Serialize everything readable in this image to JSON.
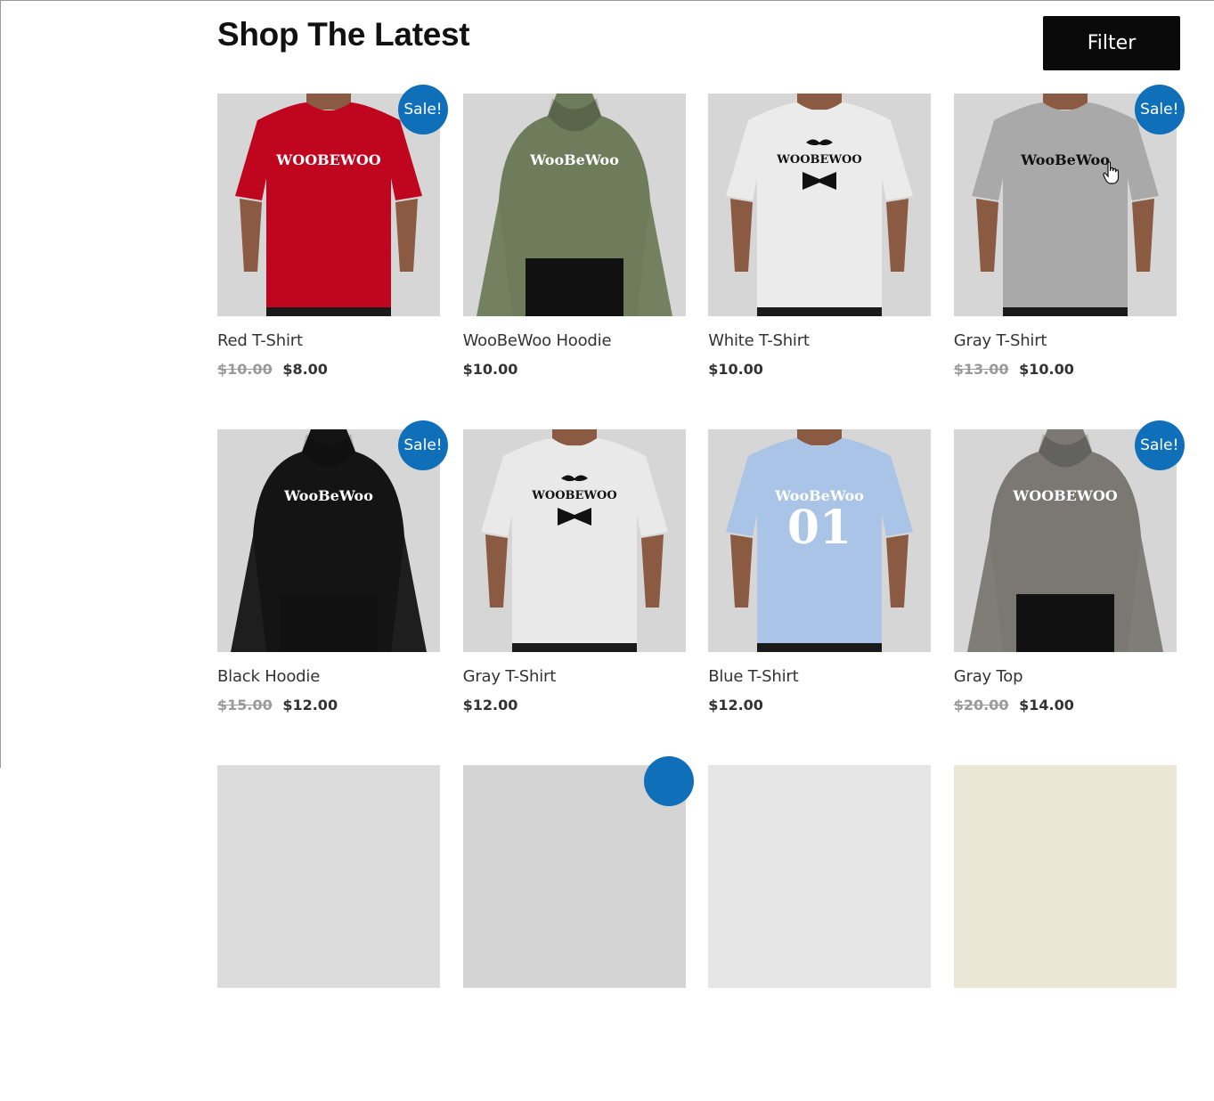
{
  "header": {
    "title": "Shop The Latest",
    "filter_label": "Filter"
  },
  "products": [
    {
      "title": "Red T-Shirt",
      "old_price": "$10.00",
      "price": "$8.00",
      "sale": "Sale!",
      "shirt_color": "#c0061f",
      "print": "WOOBEWOO",
      "kind": "tee"
    },
    {
      "title": "WooBeWoo Hoodie",
      "old_price": "",
      "price": "$10.00",
      "sale": "",
      "shirt_color": "#6e7c5b",
      "print": "WooBeWoo",
      "kind": "hoodie"
    },
    {
      "title": "White T-Shirt",
      "old_price": "",
      "price": "$10.00",
      "sale": "",
      "shirt_color": "#ebebeb",
      "print": "WOOBEWOO",
      "kind": "tee"
    },
    {
      "title": "Gray T-Shirt",
      "old_price": "$13.00",
      "price": "$10.00",
      "sale": "Sale!",
      "shirt_color": "#a9a9a9",
      "print": "WooBeWoo",
      "kind": "tee"
    },
    {
      "title": "Black Hoodie",
      "old_price": "$15.00",
      "price": "$12.00",
      "sale": "Sale!",
      "shirt_color": "#141414",
      "print": "WooBeWoo",
      "kind": "hoodie"
    },
    {
      "title": "Gray T-Shirt",
      "old_price": "",
      "price": "$12.00",
      "sale": "",
      "shirt_color": "#e9e9e9",
      "print": "WOOBEWOO",
      "kind": "tee"
    },
    {
      "title": "Blue T-Shirt",
      "old_price": "",
      "price": "$12.00",
      "sale": "",
      "shirt_color": "#a9c4e6",
      "print": "WooBeWoo",
      "print2": "01",
      "kind": "tee"
    },
    {
      "title": "Gray Top",
      "old_price": "$20.00",
      "price": "$14.00",
      "sale": "Sale!",
      "shirt_color": "#7b7873",
      "print": "WOOBEWOO",
      "kind": "hoodie"
    }
  ],
  "colors": {
    "sale_badge": "#0f6fb9",
    "filter_button": "#0a0a0a",
    "thumb_bg": "#d6d6d6"
  }
}
